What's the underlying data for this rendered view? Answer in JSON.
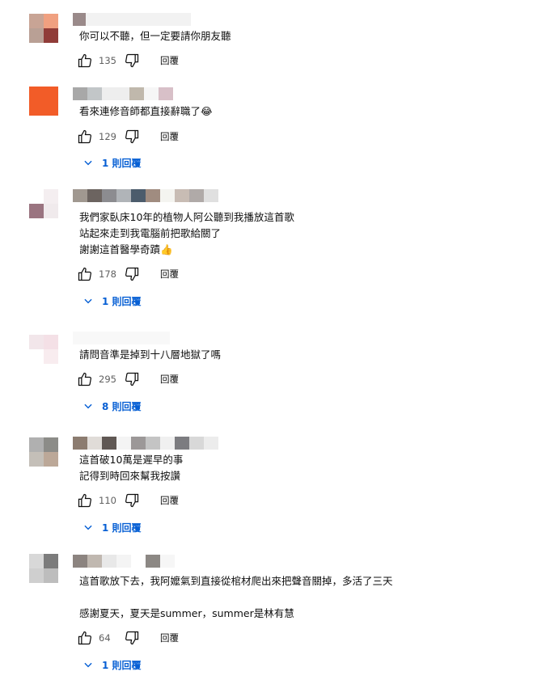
{
  "comments": [
    {
      "text": "你可以不聽，但一定要請你朋友聽",
      "likes": "135",
      "reply_label": "回覆",
      "replies_label": "",
      "avatar_colors": [
        "#c8a495",
        "#f0a080",
        "#b9a095",
        "#903c38"
      ]
    },
    {
      "text": "看來連修音師都直接辭職了😂",
      "likes": "129",
      "reply_label": "回覆",
      "replies_label": "1 則回覆",
      "avatar_colors": [
        "#f25c28",
        "#f25c28",
        "#f25c28",
        "#f25c28"
      ]
    },
    {
      "text": "我們家臥床10年的植物人阿公聽到我播放這首歌\n站起來走到我電腦前把歌給關了\n謝謝這首醫學奇蹟👍",
      "likes": "178",
      "reply_label": "回覆",
      "replies_label": "1 則回覆",
      "avatar_colors": [
        "#ffffff",
        "#f4eef0",
        "#9a7480",
        "#f0eaec"
      ]
    },
    {
      "text": "請問音準是掉到十八層地獄了嗎",
      "likes": "295",
      "reply_label": "回覆",
      "replies_label": "8 則回覆",
      "avatar_colors": [
        "#f2e6ea",
        "#f4e0e6",
        "#ffffff",
        "#f8ecef"
      ]
    },
    {
      "text": "這首破10萬是遲早的事\n記得到時回來幫我按讚",
      "likes": "110",
      "reply_label": "回覆",
      "replies_label": "1 則回覆",
      "avatar_colors": [
        "#b0b0b0",
        "#8c8c88",
        "#c4bfb8",
        "#bca898"
      ]
    },
    {
      "text": "這首歌放下去，我阿嬤氣到直接從棺材爬出來把聲音關掉，多活了三天\n\n感謝夏天，夏天是summer，summer是林有慧",
      "likes": "64",
      "reply_label": "回覆",
      "replies_label": "1 則回覆",
      "avatar_colors": [
        "#d8d8d8",
        "#7c7c7c",
        "#cfcfcf",
        "#bdbdbd"
      ]
    }
  ],
  "icons": {
    "like": "thumbs-up-icon",
    "dislike": "thumbs-down-icon",
    "expand": "chevron-down-icon"
  },
  "colors": {
    "link": "#065fd4",
    "secondary_text": "#606060"
  }
}
